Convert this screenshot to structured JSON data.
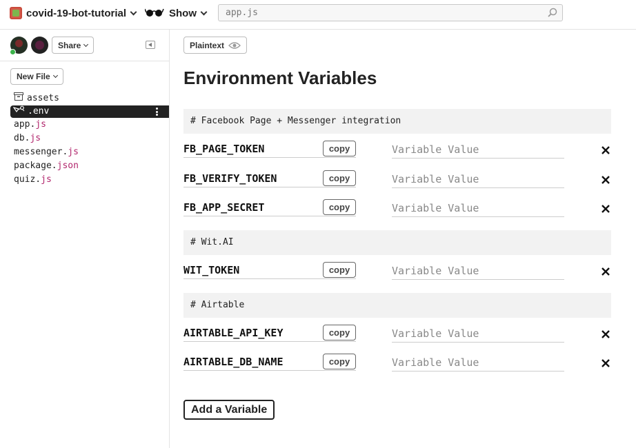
{
  "header": {
    "project_name": "covid-19-bot-tutorial",
    "show_label": "Show",
    "search": {
      "placeholder": "app.js",
      "value": ""
    }
  },
  "sidebar": {
    "share_label": "Share",
    "new_file_label": "New File",
    "files": [
      {
        "name": "assets",
        "ext": "",
        "type": "folder"
      },
      {
        "name": ".env",
        "ext": "",
        "type": "env",
        "active": true
      },
      {
        "name": "app.",
        "ext": "js",
        "type": "file"
      },
      {
        "name": "db.",
        "ext": "js",
        "type": "file"
      },
      {
        "name": "messenger.",
        "ext": "js",
        "type": "file"
      },
      {
        "name": "package.",
        "ext": "json",
        "type": "file"
      },
      {
        "name": "quiz.",
        "ext": "js",
        "type": "file"
      }
    ]
  },
  "main": {
    "plaintext_label": "Plaintext",
    "title": "Environment Variables",
    "value_placeholder": "Variable Value",
    "copy_label": "copy",
    "add_variable_label": "Add a Variable",
    "sections": [
      {
        "comment": "# Facebook Page + Messenger integration",
        "variables": [
          "FB_PAGE_TOKEN",
          "FB_VERIFY_TOKEN",
          "FB_APP_SECRET"
        ]
      },
      {
        "comment": "# Wit.AI",
        "variables": [
          "WIT_TOKEN"
        ]
      },
      {
        "comment": "# Airtable",
        "variables": [
          "AIRTABLE_API_KEY",
          "AIRTABLE_DB_NAME"
        ]
      }
    ]
  },
  "colors": {
    "extension": "#b1256c",
    "active_file_bg": "#222222",
    "online": "#3bb34a",
    "comment_bg": "#f2f2f2"
  }
}
